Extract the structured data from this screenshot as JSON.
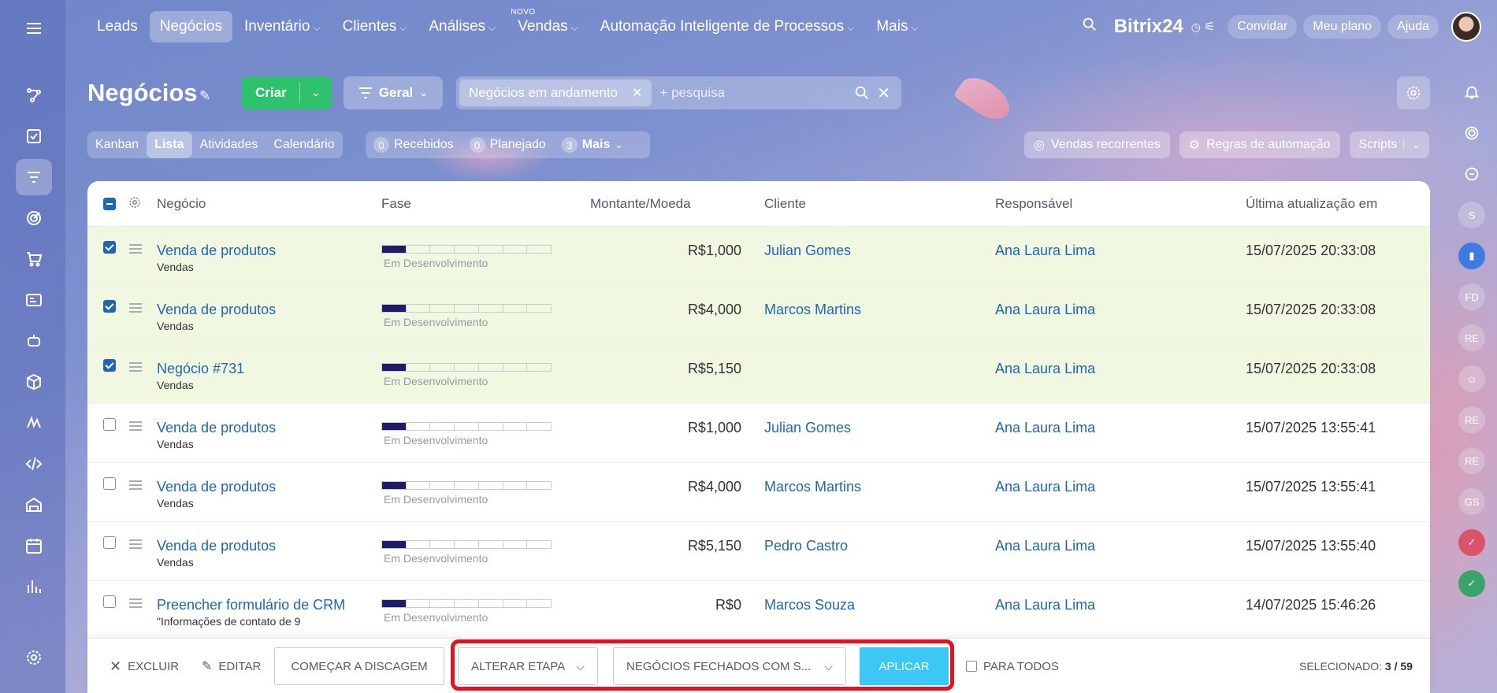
{
  "topnav": {
    "items": [
      {
        "label": "Leads",
        "dropdown": false
      },
      {
        "label": "Negócios",
        "dropdown": false,
        "active": true
      },
      {
        "label": "Inventário",
        "dropdown": true
      },
      {
        "label": "Clientes",
        "dropdown": true
      },
      {
        "label": "Análises",
        "dropdown": true
      },
      {
        "label": "Vendas",
        "dropdown": true,
        "badge": "NOVO"
      },
      {
        "label": "Automação Inteligente de Processos",
        "dropdown": true
      },
      {
        "label": "Mais",
        "dropdown": true
      }
    ],
    "brand": "Bitrix24",
    "invite_label": "Convidar",
    "plan_label": "Meu plano",
    "help_label": "Ajuda"
  },
  "header": {
    "title": "Negócios",
    "create_label": "Criar",
    "category_label": "Geral",
    "filter_chip": "Negócios em andamento",
    "search_placeholder": "+ pesquisa"
  },
  "view_tabs": [
    "Kanban",
    "Lista",
    "Atividades",
    "Calendário"
  ],
  "active_view": "Lista",
  "counters": [
    {
      "count": "0",
      "label": "Recebidos"
    },
    {
      "count": "0",
      "label": "Planejado"
    },
    {
      "count": "3",
      "label": "Mais"
    }
  ],
  "right_buttons": {
    "recurring": "Vendas recorrentes",
    "automation": "Regras de automação",
    "scripts": "Scripts"
  },
  "table": {
    "columns": [
      "Negócio",
      "Fase",
      "Montante/Moeda",
      "Cliente",
      "Responsável",
      "Última atualização em"
    ],
    "rows": [
      {
        "selected": true,
        "title": "Venda de produtos",
        "sub": "Vendas",
        "stage": "Em Desenvolvimento",
        "amount": "R$1,000",
        "client": "Julian Gomes",
        "responsible": "Ana Laura Lima",
        "updated": "15/07/2025 20:33:08"
      },
      {
        "selected": true,
        "title": "Venda de produtos",
        "sub": "Vendas",
        "stage": "Em Desenvolvimento",
        "amount": "R$4,000",
        "client": "Marcos Martins",
        "responsible": "Ana Laura Lima",
        "updated": "15/07/2025 20:33:08"
      },
      {
        "selected": true,
        "title": "Negócio #731",
        "sub": "Vendas",
        "stage": "Em Desenvolvimento",
        "amount": "R$5,150",
        "client": "",
        "responsible": "Ana Laura Lima",
        "updated": "15/07/2025 20:33:08"
      },
      {
        "selected": false,
        "title": "Venda de produtos",
        "sub": "Vendas",
        "stage": "Em Desenvolvimento",
        "amount": "R$1,000",
        "client": "Julian Gomes",
        "responsible": "Ana Laura Lima",
        "updated": "15/07/2025 13:55:41"
      },
      {
        "selected": false,
        "title": "Venda de produtos",
        "sub": "Vendas",
        "stage": "Em Desenvolvimento",
        "amount": "R$4,000",
        "client": "Marcos Martins",
        "responsible": "Ana Laura Lima",
        "updated": "15/07/2025 13:55:41"
      },
      {
        "selected": false,
        "title": "Venda de produtos",
        "sub": "Vendas",
        "stage": "Em Desenvolvimento",
        "amount": "R$5,150",
        "client": "Pedro Castro",
        "responsible": "Ana Laura Lima",
        "updated": "15/07/2025 13:55:40"
      },
      {
        "selected": false,
        "title": "Preencher formulário de CRM",
        "sub": "\"Informações de contato de 9",
        "stage": "Em Desenvolvimento",
        "amount": "R$0",
        "client": "Marcos Souza",
        "responsible": "Ana Laura Lima",
        "updated": "14/07/2025 15:46:26"
      }
    ]
  },
  "action_bar": {
    "delete_label": "EXCLUIR",
    "edit_label": "EDITAR",
    "dial_label": "COMEÇAR A DISCAGEM",
    "change_stage_label": "ALTERAR ETAPA",
    "stage_select_value": "NEGÓCIOS FECHADOS COM S...",
    "apply_label": "APLICAR",
    "for_all_label": "PARA TODOS",
    "selected_label": "SELECIONADO:",
    "selected_value": "3 / 59"
  },
  "right_rail": [
    "S",
    "FD",
    "RE",
    "RE",
    "RE",
    "GS"
  ],
  "colors": {
    "create_green": "#2fc26c",
    "link_blue": "#2067b0",
    "apply_blue": "#3bc8f5",
    "stage_fill": "#1e1b6b",
    "selected_row": "#f1f8e2",
    "highlight_red": "#e6101e"
  },
  "icons": {
    "menu": "hamburger-icon",
    "search": "search-icon",
    "settings": "gear-icon",
    "pin": "pin-icon",
    "delete": "close-icon",
    "edit": "pencil-icon"
  }
}
